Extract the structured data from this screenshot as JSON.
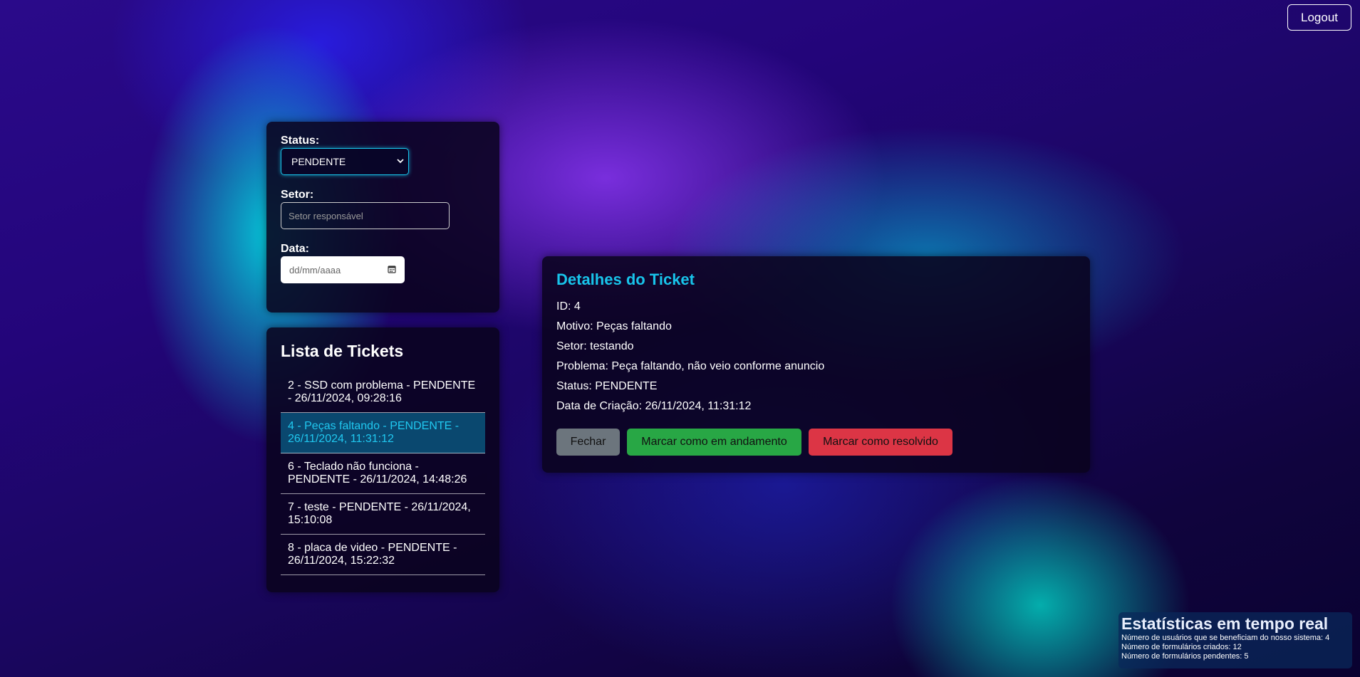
{
  "header": {
    "logout_label": "Logout"
  },
  "filters": {
    "status_label": "Status:",
    "status_value": "PENDENTE",
    "setor_label": "Setor:",
    "setor_placeholder": "Setor responsável",
    "data_label": "Data:",
    "data_placeholder": "dd/mm/aaaa"
  },
  "ticket_list": {
    "title": "Lista de Tickets",
    "items": [
      {
        "label": "2 - SSD com problema - PENDENTE - 26/11/2024, 09:28:16",
        "selected": false
      },
      {
        "label": "4 - Peças faltando - PENDENTE - 26/11/2024, 11:31:12",
        "selected": true
      },
      {
        "label": "6 - Teclado não funciona - PENDENTE - 26/11/2024, 14:48:26",
        "selected": false
      },
      {
        "label": "7 - teste - PENDENTE - 26/11/2024, 15:10:08",
        "selected": false
      },
      {
        "label": "8 - placa de video - PENDENTE - 26/11/2024, 15:22:32",
        "selected": false
      }
    ]
  },
  "details": {
    "title": "Detalhes do Ticket",
    "id": "ID: 4",
    "motivo": "Motivo: Peças faltando",
    "setor": "Setor: testando",
    "problema": "Problema: Peça faltando, não veio conforme anuncio",
    "status": "Status: PENDENTE",
    "data_criacao": "Data de Criação: 26/11/2024, 11:31:12",
    "btn_fechar": "Fechar",
    "btn_andamento": "Marcar como em andamento",
    "btn_resolvido": "Marcar como resolvido"
  },
  "stats": {
    "title": "Estatísticas em tempo real",
    "usuarios": "Número de usuários que se beneficiam do nosso sistema: 4",
    "criados": "Número de formulários criados: 12",
    "pendentes": "Número de formulários pendentes: 5"
  },
  "colors": {
    "accent": "#18c4ea",
    "btn_fechar": "#6c757d",
    "btn_andamento": "#28a745",
    "btn_resolvido": "#dc3545"
  },
  "icons": {
    "status_select": "chevron-down-icon",
    "date_input": "calendar-icon"
  }
}
